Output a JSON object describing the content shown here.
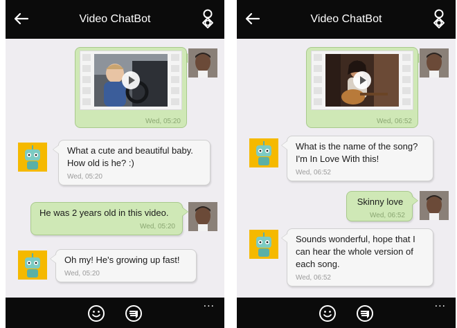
{
  "panels": [
    {
      "title": "Video ChatBot",
      "video": {
        "timestamp": "Wed, 05:20"
      },
      "messages": [
        {
          "sender": "bot",
          "text": "What a cute and beautiful baby. How old is he? :)",
          "timestamp": "Wed, 05:20"
        },
        {
          "sender": "user",
          "text": "He was 2 years old in this video.",
          "timestamp": "Wed, 05:20"
        },
        {
          "sender": "bot",
          "text": "Oh my! He's growing up fast!",
          "timestamp": "Wed, 05:20"
        }
      ],
      "bottom": {
        "more": "..."
      }
    },
    {
      "title": "Video ChatBot",
      "video": {
        "timestamp": "Wed, 06:52"
      },
      "messages": [
        {
          "sender": "bot",
          "text": "What is the name of the song? I'm In Love With this!",
          "timestamp": "Wed, 06:52"
        },
        {
          "sender": "user",
          "text": "Skinny love",
          "timestamp": "Wed, 06:52"
        },
        {
          "sender": "bot",
          "text": "Sounds wonderful, hope that I can hear the whole version of each song.",
          "timestamp": "Wed, 06:52"
        }
      ],
      "bottom": {
        "more": "..."
      }
    }
  ],
  "icons": {
    "back": "back-arrow-icon",
    "profile": "profile-icon",
    "smiley": "smiley-icon",
    "dislike": "thumbs-down-icon",
    "more": "more-dots-icon",
    "play": "play-icon"
  },
  "colors": {
    "topbar": "#0b0b0b",
    "background": "#efedf1",
    "user_bubble": "#cfe8b6",
    "bot_bubble": "#f6f6f6",
    "bot_avatar": "#f5b900"
  }
}
